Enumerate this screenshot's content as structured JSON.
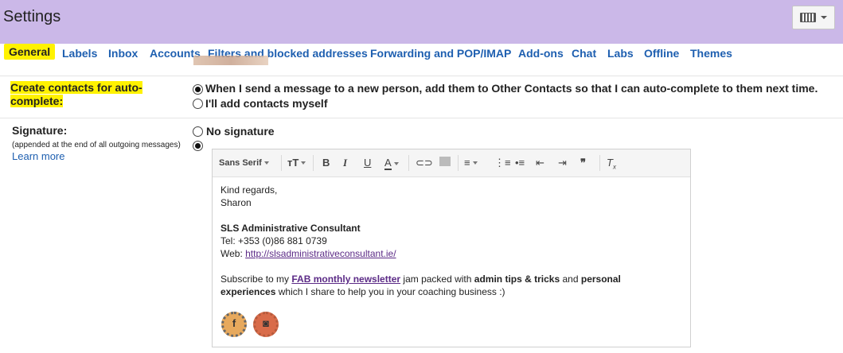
{
  "header": {
    "title": "Settings"
  },
  "tabs": [
    {
      "label": "General",
      "active": true
    },
    {
      "label": "Labels"
    },
    {
      "label": "Inbox"
    },
    {
      "label": "Accounts"
    },
    {
      "label": "Filters and blocked addresses"
    },
    {
      "label": "Forwarding and POP/IMAP"
    },
    {
      "label": "Add-ons"
    },
    {
      "label": "Chat"
    },
    {
      "label": "Labs"
    },
    {
      "label": "Offline"
    },
    {
      "label": "Themes"
    }
  ],
  "contacts": {
    "label_line1": "Create contacts for auto-",
    "label_line2": "complete:",
    "option1": "When I send a message to a new person, add them to Other Contacts so that I can auto-complete to them next time.",
    "option2": "I'll add contacts myself",
    "selected": "option1"
  },
  "signature": {
    "label": "Signature:",
    "note": "(appended at the end of all outgoing messages)",
    "learn_more": "Learn more",
    "no_signature": "No signature",
    "toolbar": {
      "font": "Sans Serif"
    },
    "body": {
      "line1": "Kind regards,",
      "line2": "Sharon",
      "company": "SLS Administrative Consultant",
      "tel": "Tel: +353 (0)86 881 0739",
      "web_prefix": "Web: ",
      "web_link": "http://slsadministrativeconsultant.ie/",
      "sub_1": "Subscribe to my ",
      "sub_link": "FAB monthly newsletter",
      "sub_2": " jam packed with ",
      "sub_bold1": "admin tips & tricks",
      "sub_3": " and ",
      "sub_bold2": "personal",
      "line_b_bold": "experiences",
      "line_b_rest": " which I share to help you in your coaching business :)"
    },
    "social": [
      {
        "icon": "facebook-icon",
        "glyph": "f"
      },
      {
        "icon": "instagram-icon",
        "glyph": "◙"
      }
    ]
  },
  "colors": {
    "header_bg": "#cbb8e8",
    "link": "#1e5fb0",
    "highlight": "#fff200"
  }
}
